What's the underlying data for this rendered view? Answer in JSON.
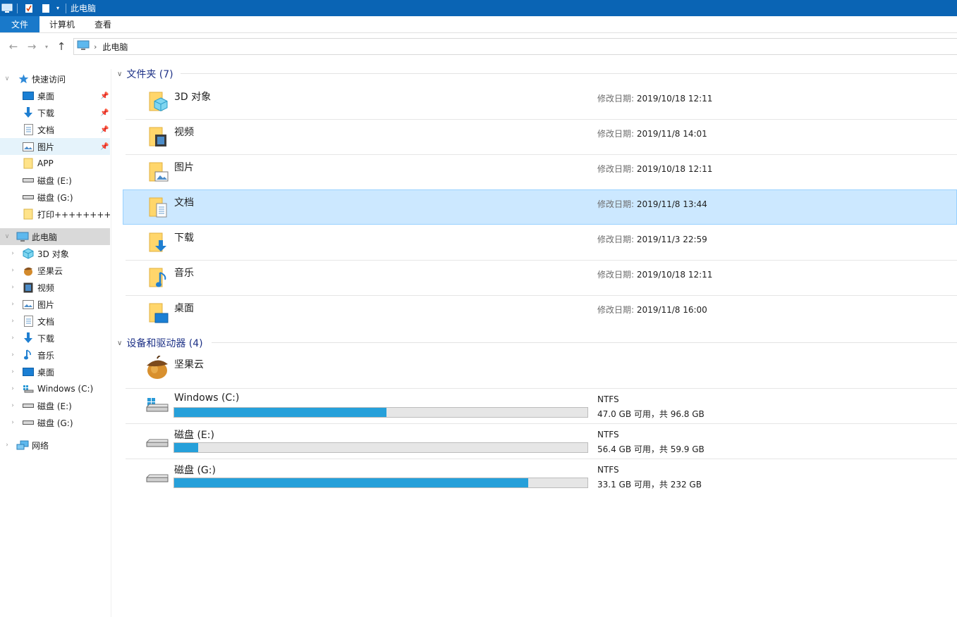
{
  "window": {
    "title": "此电脑"
  },
  "ribbon": {
    "tabs": [
      "文件",
      "计算机",
      "查看"
    ]
  },
  "address": {
    "path": "此电脑"
  },
  "sidebar": {
    "quick_access": "快速访问",
    "quick_items": [
      {
        "label": "桌面",
        "icon": "desktop-icon",
        "pinned": true
      },
      {
        "label": "下载",
        "icon": "download-icon",
        "pinned": true
      },
      {
        "label": "文档",
        "icon": "document-icon",
        "pinned": true
      },
      {
        "label": "图片",
        "icon": "picture-icon",
        "pinned": true
      },
      {
        "label": "APP",
        "icon": "folder-icon",
        "pinned": false
      },
      {
        "label": "磁盘 (E:)",
        "icon": "drive-icon",
        "pinned": false
      },
      {
        "label": "磁盘 (G:)",
        "icon": "drive-icon",
        "pinned": false
      },
      {
        "label": "打印+++++++++",
        "icon": "folder-icon",
        "pinned": false
      }
    ],
    "this_pc": "此电脑",
    "pc_items": [
      {
        "label": "3D 对象",
        "icon": "3d-objects-icon"
      },
      {
        "label": "坚果云",
        "icon": "nutstore-icon"
      },
      {
        "label": "视频",
        "icon": "video-icon"
      },
      {
        "label": "图片",
        "icon": "picture-icon"
      },
      {
        "label": "文档",
        "icon": "document-icon"
      },
      {
        "label": "下载",
        "icon": "download-icon"
      },
      {
        "label": "音乐",
        "icon": "music-icon"
      },
      {
        "label": "桌面",
        "icon": "desktop-icon"
      },
      {
        "label": "Windows (C:)",
        "icon": "windows-drive-icon"
      },
      {
        "label": "磁盘 (E:)",
        "icon": "drive-icon"
      },
      {
        "label": "磁盘 (G:)",
        "icon": "drive-icon"
      }
    ],
    "network": "网络"
  },
  "folders_header": "文件夹 (7)",
  "folders": [
    {
      "name": "3D 对象",
      "date_label": "修改日期:",
      "date": "2019/10/18 12:11",
      "icon": "3d-objects-icon"
    },
    {
      "name": "视频",
      "date_label": "修改日期:",
      "date": "2019/11/8 14:01",
      "icon": "video-icon"
    },
    {
      "name": "图片",
      "date_label": "修改日期:",
      "date": "2019/10/18 12:11",
      "icon": "picture-icon"
    },
    {
      "name": "文档",
      "date_label": "修改日期:",
      "date": "2019/11/8 13:44",
      "icon": "document-icon",
      "selected": true
    },
    {
      "name": "下载",
      "date_label": "修改日期:",
      "date": "2019/11/3 22:59",
      "icon": "download-icon"
    },
    {
      "name": "音乐",
      "date_label": "修改日期:",
      "date": "2019/10/18 12:11",
      "icon": "music-icon"
    },
    {
      "name": "桌面",
      "date_label": "修改日期:",
      "date": "2019/11/8 16:00",
      "icon": "desktop-icon"
    }
  ],
  "devices_header": "设备和驱动器 (4)",
  "devices": [
    {
      "name": "坚果云",
      "icon": "nutstore-icon"
    },
    {
      "name": "Windows (C:)",
      "fs": "NTFS",
      "free_text": "47.0 GB 可用，共 96.8 GB",
      "used_fraction": 0.5145,
      "icon": "windows-drive-icon"
    },
    {
      "name": "磁盘 (E:)",
      "fs": "NTFS",
      "free_text": "56.4 GB 可用，共 59.9 GB",
      "used_fraction": 0.0584,
      "icon": "drive-icon"
    },
    {
      "name": "磁盘 (G:)",
      "fs": "NTFS",
      "free_text": "33.1 GB 可用，共 232 GB",
      "used_fraction": 0.8573,
      "icon": "drive-icon"
    }
  ],
  "colors": {
    "titlebar": "#0a64b4",
    "accent": "#1979ca",
    "selection": "#cce8ff",
    "bar_fill": "#26a0da",
    "group_header": "#1e3287"
  }
}
